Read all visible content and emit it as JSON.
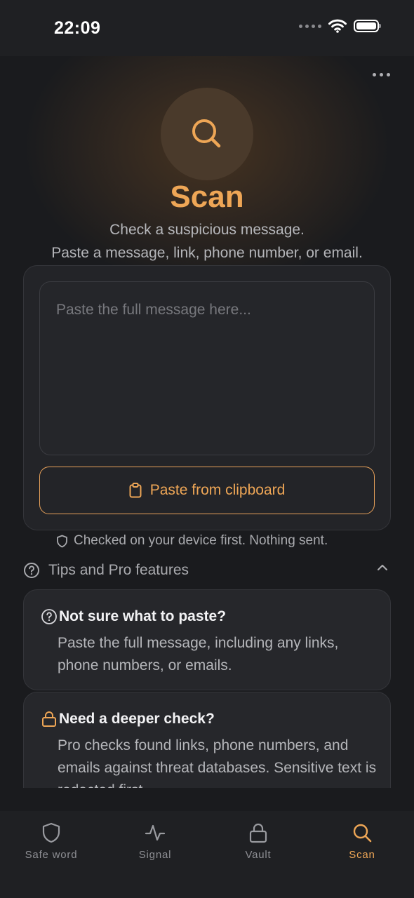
{
  "status_bar": {
    "time": "22:09"
  },
  "header": {
    "title": "Scan",
    "subtitle_line1": "Check a suspicious message.",
    "subtitle_line2": "Paste a message, link, phone number, or email."
  },
  "input": {
    "placeholder": "Paste the full message here...",
    "value": "",
    "paste_button_label": "Paste from clipboard"
  },
  "privacy_note": "Checked on your device first. Nothing sent.",
  "tips": {
    "header_label": "Tips and Pro features",
    "items": [
      {
        "title": "Not sure what to paste?",
        "body": "Paste the full message, including any links, phone numbers, or emails.",
        "icon": "question-circle-icon"
      },
      {
        "title": "Need a deeper check?",
        "body": "Pro checks found links, phone numbers, and emails against threat databases. Sensitive text is redacted first.",
        "icon": "lock-icon"
      }
    ]
  },
  "tab_bar": {
    "items": [
      {
        "label": "Safe word",
        "icon": "shield-icon",
        "active": false
      },
      {
        "label": "Signal",
        "icon": "activity-icon",
        "active": false
      },
      {
        "label": "Vault",
        "icon": "lock-icon",
        "active": false
      },
      {
        "label": "Scan",
        "icon": "search-icon",
        "active": true
      }
    ]
  },
  "colors": {
    "accent": "#eea656",
    "background": "#1a1b1e",
    "card": "#26272b",
    "muted_text": "#b5b6ba"
  }
}
